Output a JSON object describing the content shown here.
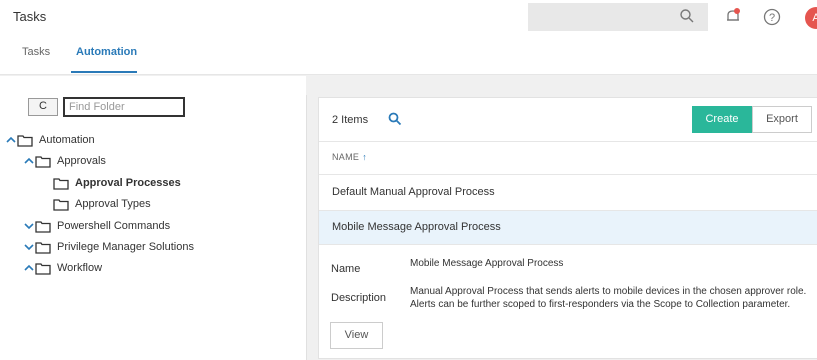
{
  "header": {
    "title": "Tasks",
    "avatar_initial": "A",
    "tabs": [
      {
        "label": "Tasks"
      },
      {
        "label": "Automation"
      }
    ]
  },
  "sidebar": {
    "refresh_label": "C",
    "find_placeholder": "Find Folder",
    "tree": [
      {
        "label": "Automation",
        "chevron": "up"
      },
      {
        "label": "Approvals",
        "chevron": "up"
      },
      {
        "label": "Approval Processes",
        "selected": true
      },
      {
        "label": "Approval Types"
      },
      {
        "label": "Powershell Commands",
        "chevron": "down"
      },
      {
        "label": "Privilege Manager Solutions",
        "chevron": "down"
      },
      {
        "label": "Workflow",
        "chevron": "up"
      }
    ]
  },
  "main": {
    "items_count": "2 Items",
    "create_label": "Create",
    "export_label": "Export",
    "column_header": "NAME",
    "sort_indicator": "↑",
    "rows": [
      {
        "name": "Default Manual Approval Process"
      },
      {
        "name": "Mobile Message Approval Process"
      }
    ],
    "details": {
      "name_label": "Name",
      "name_value": "Mobile Message Approval Process",
      "description_label": "Description",
      "description_line1": "Manual Approval Process that sends alerts to mobile devices in the chosen approver role.",
      "description_line2": "Alerts can be further scoped to first-responders via the Scope to Collection parameter.",
      "view_label": "View"
    }
  },
  "colors": {
    "accent": "#2a7ab8",
    "create": "#2ab79a",
    "avatar": "#e5554f",
    "bell_dot": "#e5554f",
    "selected_row": "#e9f3fb"
  }
}
